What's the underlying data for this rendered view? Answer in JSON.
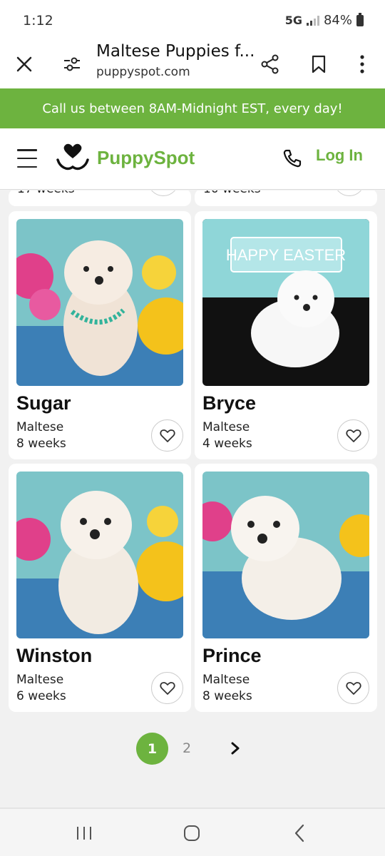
{
  "status": {
    "time": "1:12",
    "network": "5G",
    "battery": "84%"
  },
  "browser": {
    "title": "Maltese Puppies f...",
    "url": "puppyspot.com"
  },
  "banner": {
    "text": "Call us between 8AM-Midnight EST, every day!"
  },
  "site": {
    "logo_text": "PuppySpot",
    "login_label": "Log In",
    "brand_color": "#6db33f"
  },
  "partial_cards": [
    {
      "age": "17 weeks"
    },
    {
      "age": "10 weeks"
    }
  ],
  "puppies": [
    {
      "name": "Sugar",
      "breed": "Maltese",
      "age": "8 weeks"
    },
    {
      "name": "Bryce",
      "breed": "Maltese",
      "age": "4 weeks",
      "photo_sign": "HAPPY EASTER"
    },
    {
      "name": "Winston",
      "breed": "Maltese",
      "age": "6 weeks"
    },
    {
      "name": "Prince",
      "breed": "Maltese",
      "age": "8 weeks"
    }
  ],
  "pagination": {
    "current": "1",
    "next_page": "2"
  }
}
